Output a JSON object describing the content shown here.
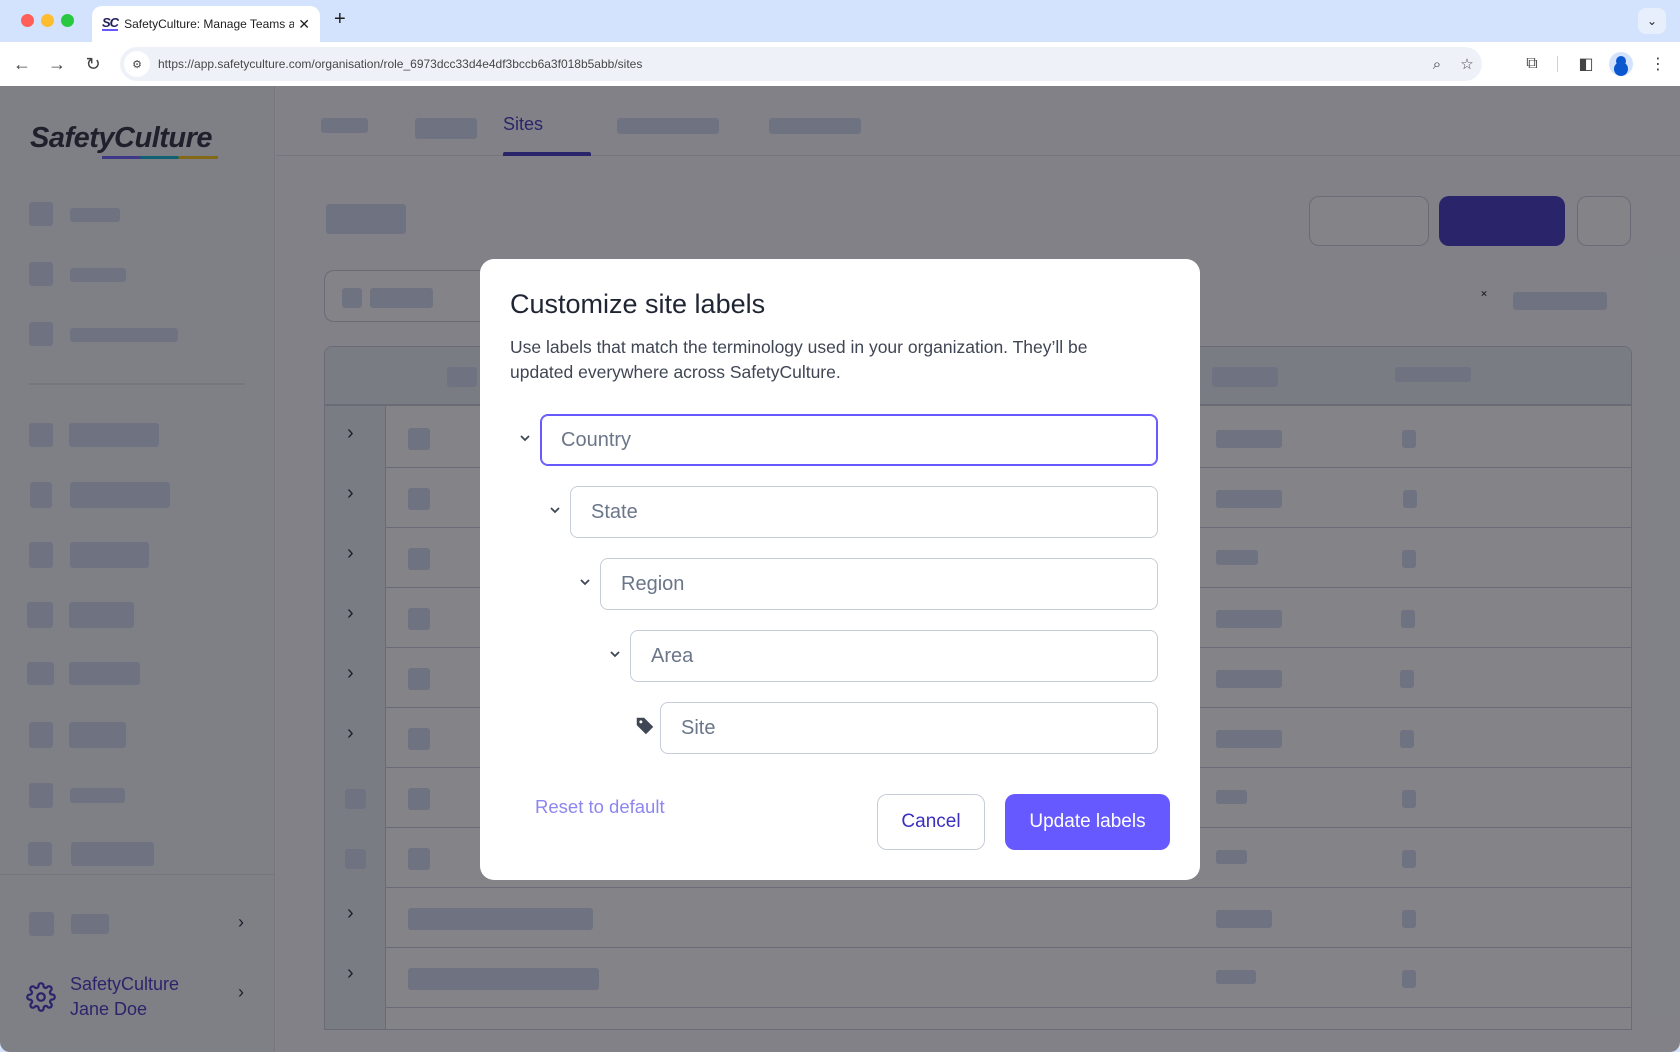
{
  "browser": {
    "tab_title": "SafetyCulture: Manage Teams and...",
    "tab_favicon": "SC",
    "url": "https://app.safetyculture.com/organisation/role_6973dcc33d4e4df3bccb6a3f018b5abb/sites",
    "icons": [
      "back-icon",
      "forward-icon",
      "reload-icon",
      "site-info-icon",
      "zoom-icon",
      "bookmark-star-icon",
      "extensions-icon",
      "side-panel-icon",
      "profile-icon",
      "menu-icon"
    ]
  },
  "app": {
    "logo": "SafetyCulture",
    "sidebar": {
      "settings": {
        "org_name": "SafetyCulture",
        "user_name": "Jane Doe"
      }
    },
    "tabs": {
      "active_label": "Sites"
    }
  },
  "modal": {
    "title": "Customize site labels",
    "description": "Use labels that match the terminology used in your organization. They’ll be updated everywhere across SafetyCulture.",
    "levels": [
      {
        "placeholder": "Country",
        "value": "",
        "icon": "chevron-down-icon",
        "focused": true
      },
      {
        "placeholder": "State",
        "value": "",
        "icon": "chevron-down-icon"
      },
      {
        "placeholder": "Region",
        "value": "",
        "icon": "chevron-down-icon"
      },
      {
        "placeholder": "Area",
        "value": "",
        "icon": "chevron-down-icon"
      },
      {
        "placeholder": "Site",
        "value": "",
        "icon": "tag-icon"
      }
    ],
    "reset_label": "Reset to default",
    "cancel_label": "Cancel",
    "update_label": "Update labels"
  },
  "colors": {
    "accent": "#6559ff",
    "brand_dark": "#3a2fbf"
  }
}
